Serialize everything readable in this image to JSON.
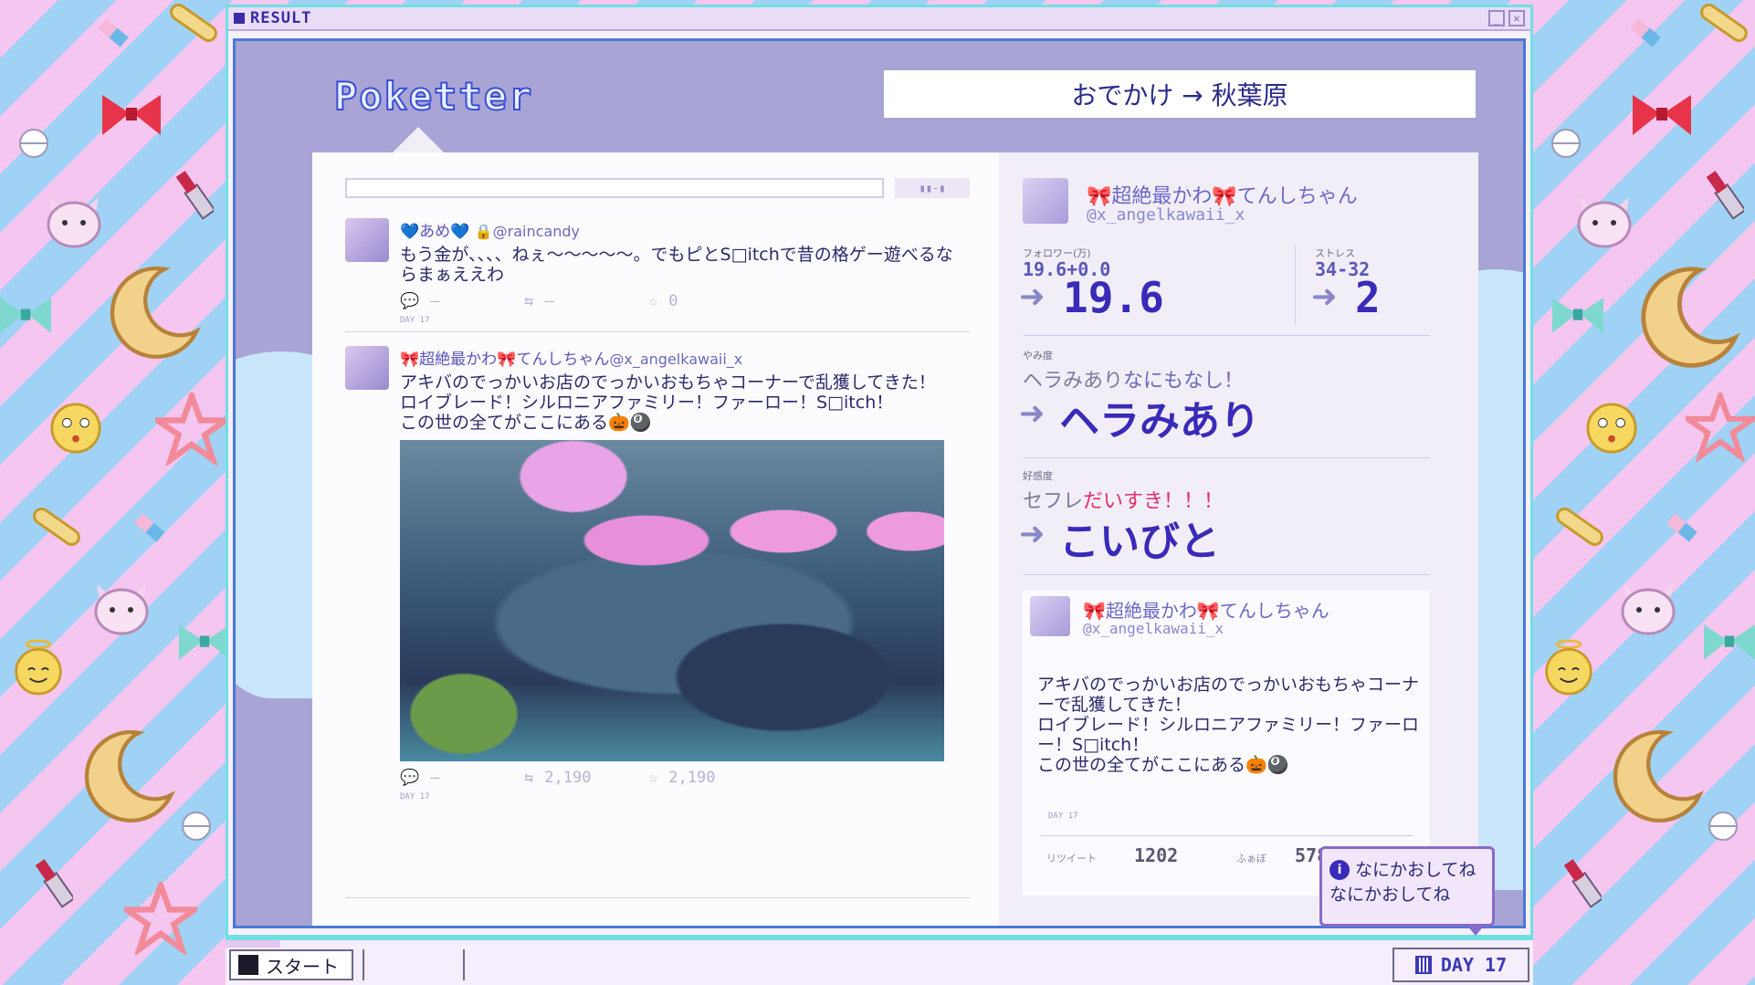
{
  "window": {
    "title": "RESULT",
    "controls": [
      "minimize",
      "close"
    ]
  },
  "app": {
    "logo": "Poketter",
    "location": "おでかけ → 秋葉原",
    "search_button": "▮▮-▮"
  },
  "tweets": [
    {
      "name": "💙あめ💙",
      "handle": "🔒@raincandy",
      "text": "もう金が、、、、ねぇ～～～～～。でもピとS□itchで昔の格ゲー遊べるならまぁええわ",
      "reply": "—",
      "retweets": "—",
      "likes": "0",
      "day": "DAY 17"
    },
    {
      "name": "🎀超絶最かわ🎀てんしちゃん",
      "handle": "@x_angelkawaii_x",
      "text": "アキバのでっかいお店のでっかいおもちゃコーナーで乱獲してきた！\nロイブレード！シルロニアファミリー！ファーロー！S□itch！\nこの世の全てがここにある🎃🎱",
      "reply": "—",
      "retweets": "2,190",
      "likes": "2,190",
      "day": "DAY 17"
    }
  ],
  "profile": {
    "name": "🎀超絶最かわ🎀てんしちゃん",
    "handle": "@x_angelkawaii_x",
    "followers_label": "フォロワー(万)",
    "followers_change": "19.6+0.0",
    "followers_value": "19.6",
    "stress_label": "ストレス",
    "stress_change": "34-32",
    "stress_value": "2",
    "yami_label": "やみ度",
    "yami_sub_a": "ヘラみあり",
    "yami_sub_b": "なにもなし！",
    "yami_value": "ヘラみあり",
    "affection_label": "好感度",
    "affection_sub_a": "セフレ",
    "affection_sub_b": "だいすき！！！",
    "affection_value": "こいびと"
  },
  "embed": {
    "name": "🎀超絶最かわ🎀てんしちゃん",
    "handle": "@x_angelkawaii_x",
    "text": "アキバのでっかいお店のでっかいおもちゃコーナーで乱獲してきた！\nロイブレード！シルロニアファミリー！ファーロー！S□itch！\nこの世の全てがここにある🎃🎱",
    "day": "DAY 17",
    "retweet_label": "リツイート",
    "retweet_value": "1202",
    "fav_label": "ふぁぼ",
    "fav_value": "5785"
  },
  "tooltip": {
    "line1": "なにかおしてね",
    "line2": "なにかおしてね"
  },
  "taskbar": {
    "start_label": "スタート",
    "day_label": "DAY 17"
  },
  "colors": {
    "accent": "#3a2ab8",
    "window_border": "#6fe0e0",
    "stage_bg": "#a8a4d6",
    "love": "#e0306a"
  }
}
